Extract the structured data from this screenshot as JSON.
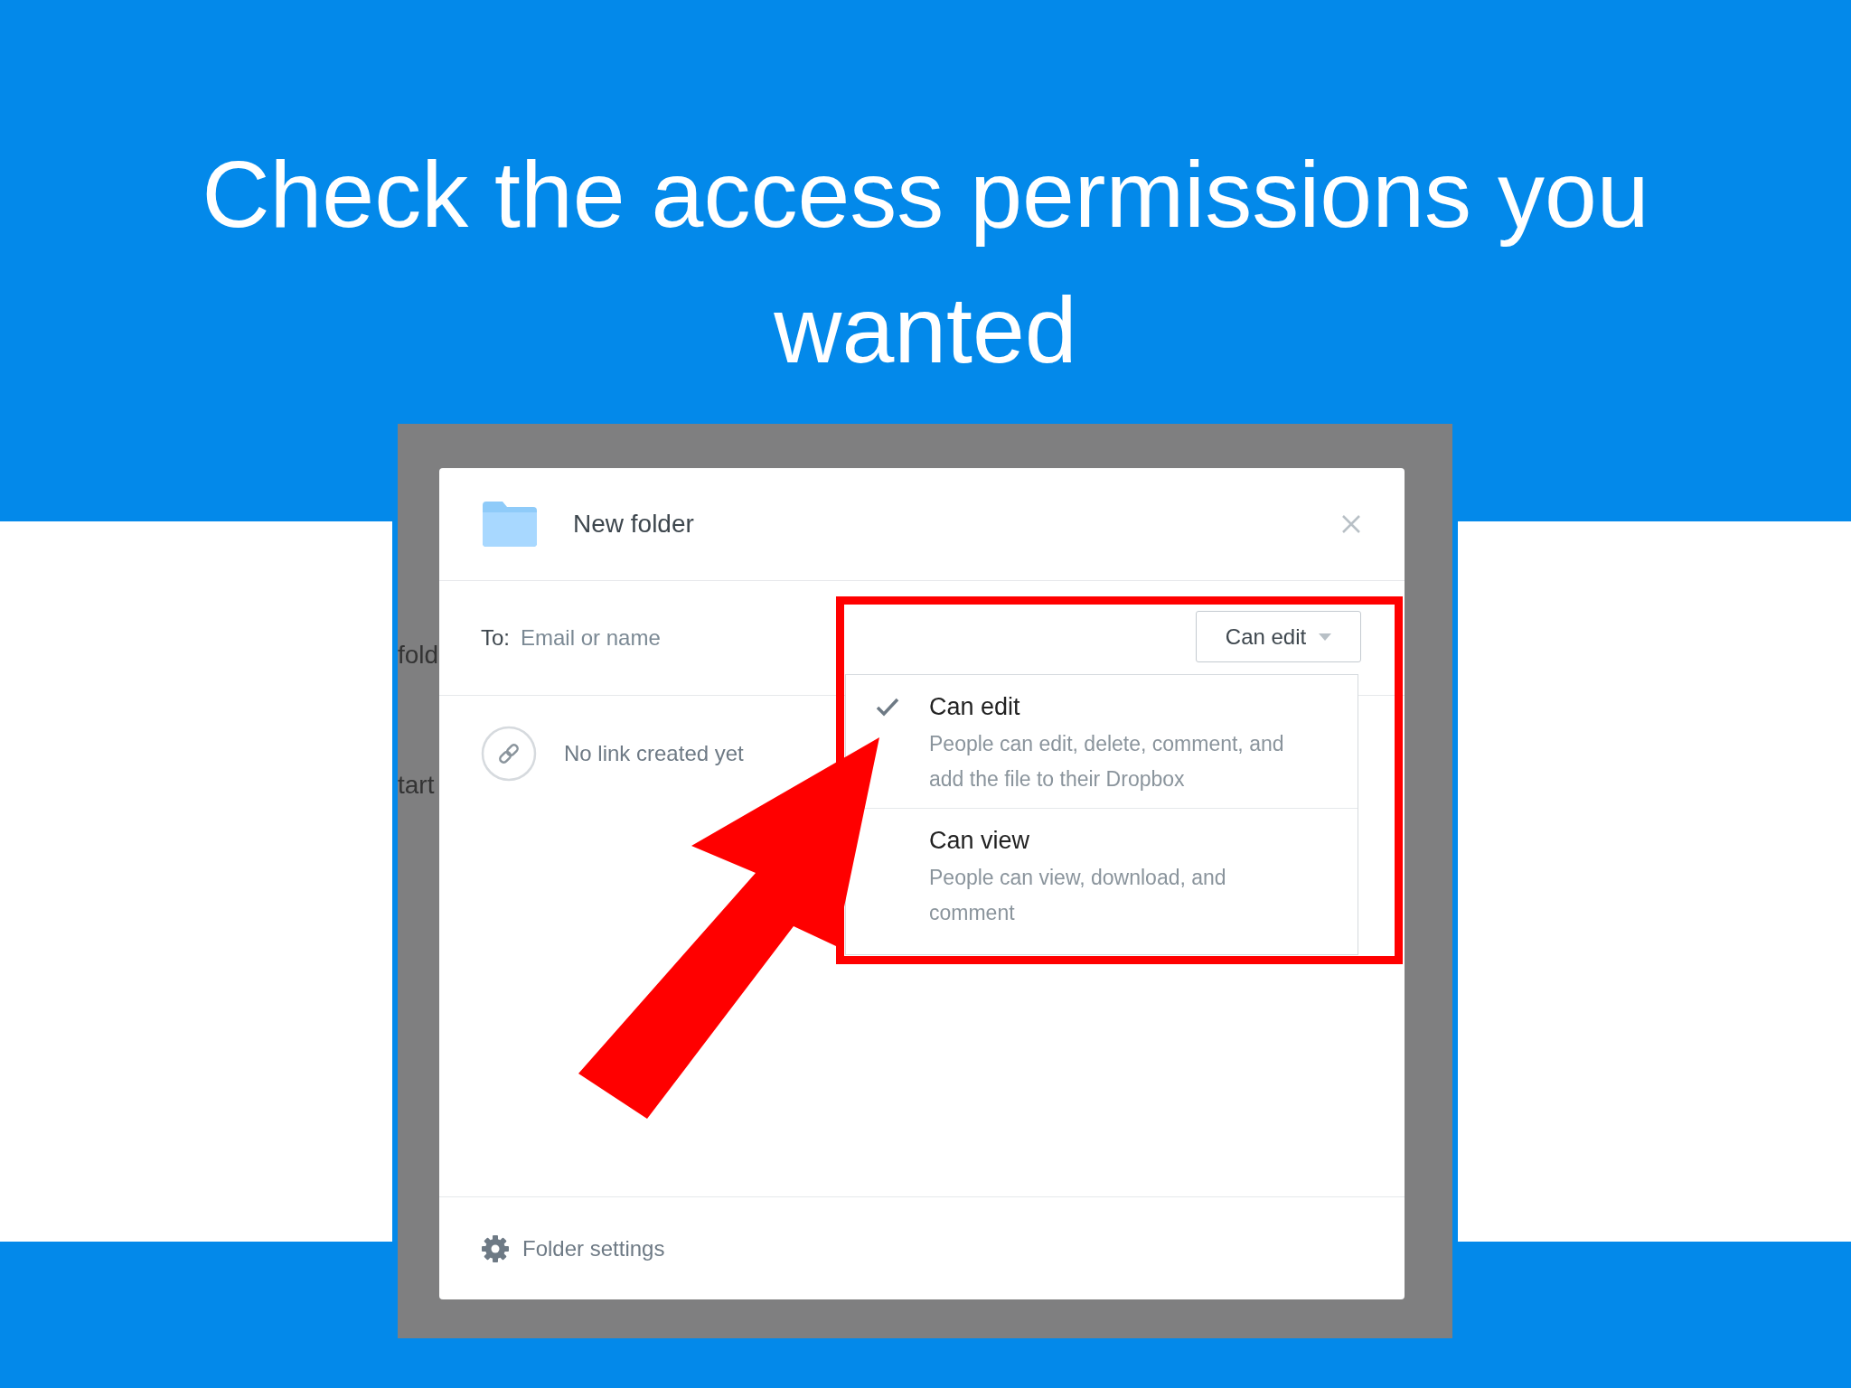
{
  "slide": {
    "title": "Check the access permissions you wanted"
  },
  "background_app": {
    "texts": [
      "fold",
      "tart"
    ]
  },
  "dialog": {
    "title": "New folder",
    "to_label": "To:",
    "to_placeholder": "Email or name",
    "permission_button": "Can edit",
    "link_status": "No link created yet",
    "footer": "Folder settings",
    "permission_menu": [
      {
        "label": "Can edit",
        "description": "People can edit, delete, comment, and add the file to their Dropbox",
        "selected": true
      },
      {
        "label": "Can view",
        "description": "People can view, download, and comment",
        "selected": false
      }
    ]
  }
}
